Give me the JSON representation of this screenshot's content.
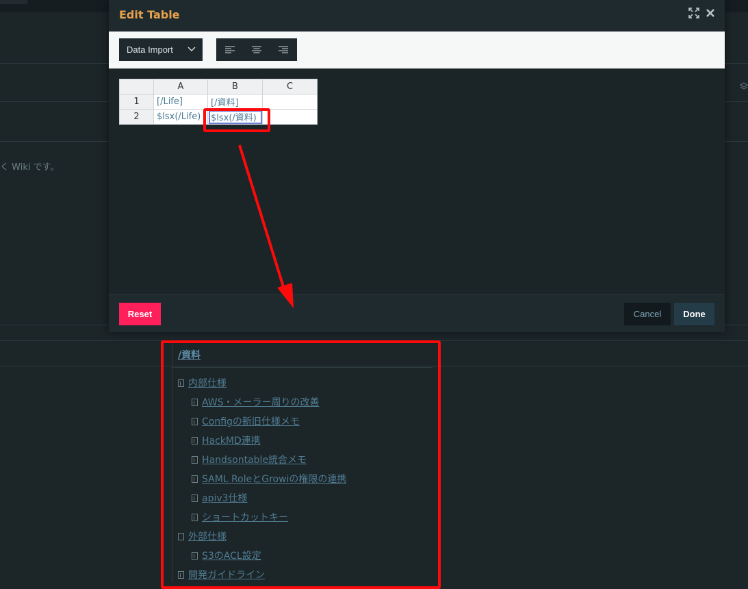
{
  "background": {
    "partial_text": "く Wiki です。"
  },
  "modal": {
    "title": "Edit Table",
    "icons": [
      "expand-icon",
      "close-icon"
    ],
    "toolbar": {
      "data_import_label": "Data Import",
      "align_buttons": [
        "align-left-icon",
        "align-center-icon",
        "align-right-icon"
      ]
    },
    "grid": {
      "columns": [
        "A",
        "B",
        "C"
      ],
      "rows": [
        {
          "num": "1",
          "cells": [
            "[/Life]",
            "[/資料]",
            ""
          ]
        },
        {
          "num": "2",
          "cells": [
            "$lsx(/Life)",
            "$lsx(/資料)",
            ""
          ]
        }
      ]
    },
    "footer": {
      "reset_label": "Reset",
      "cancel_label": "Cancel",
      "done_label": "Done"
    }
  },
  "page_list": {
    "title": "/資料",
    "items": [
      {
        "label": "内部仕様",
        "level": 0,
        "icon": "page-icon"
      },
      {
        "label": "AWS・メーラー周りの改善",
        "level": 1,
        "icon": "page-icon"
      },
      {
        "label": "Configの新旧仕様メモ",
        "level": 1,
        "icon": "page-icon"
      },
      {
        "label": "HackMD連携",
        "level": 1,
        "icon": "page-icon"
      },
      {
        "label": "Handsontable統合メモ",
        "level": 1,
        "icon": "page-icon"
      },
      {
        "label": "SAML RoleとGrowiの権限の連携",
        "level": 1,
        "icon": "page-icon"
      },
      {
        "label": "apiv3仕様",
        "level": 1,
        "icon": "page-icon"
      },
      {
        "label": "ショートカットキー",
        "level": 1,
        "icon": "page-icon"
      },
      {
        "label": "外部仕様",
        "level": 0,
        "icon": "empty-page-icon"
      },
      {
        "label": "S3のACL設定",
        "level": 1,
        "icon": "page-icon"
      },
      {
        "label": "開発ガイドライン",
        "level": 0,
        "icon": "page-icon"
      }
    ]
  },
  "colors": {
    "accent_title": "#e8a24d",
    "reset": "#ff1f5a",
    "highlight": "#ff0a0a",
    "link": "#4f7c92"
  }
}
